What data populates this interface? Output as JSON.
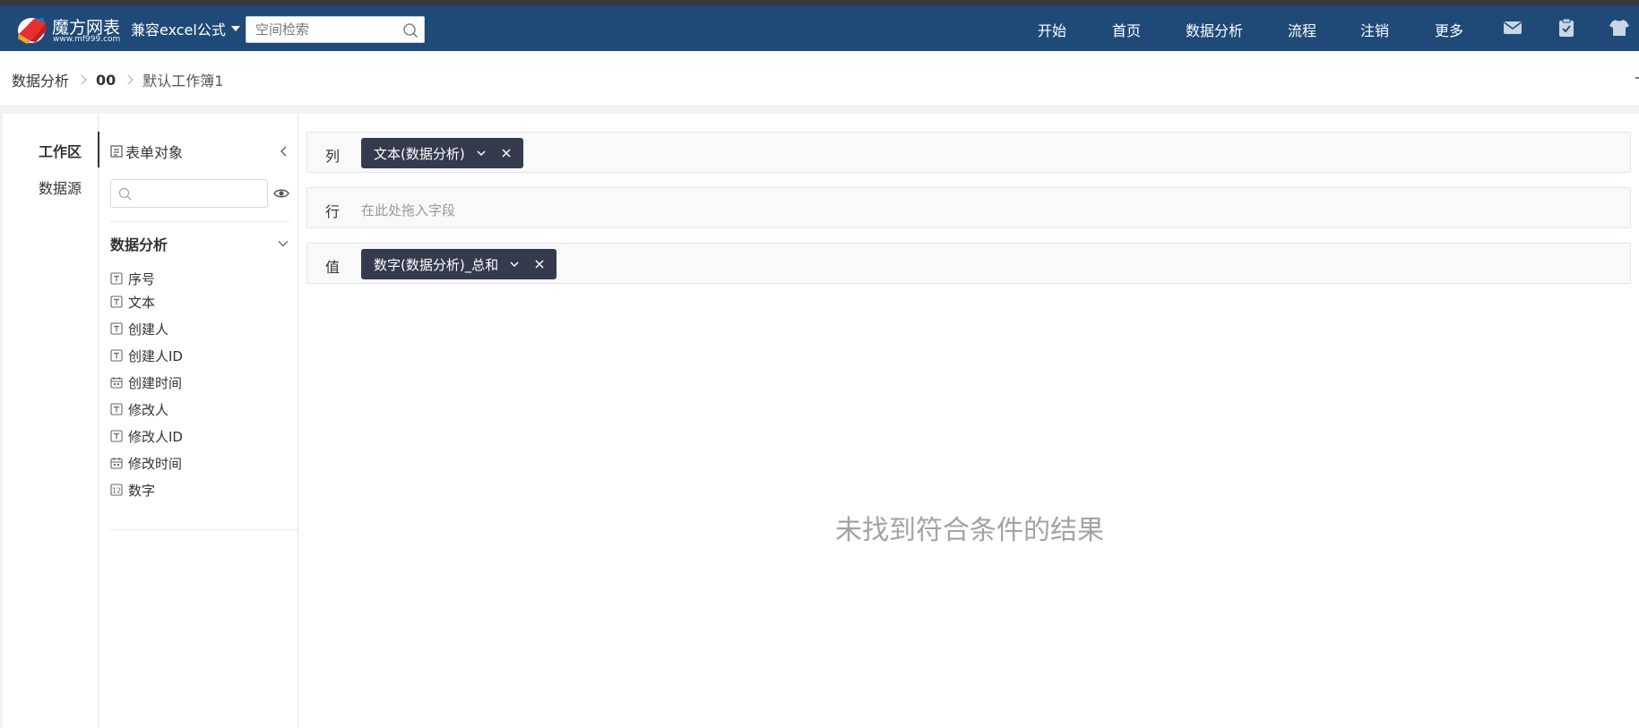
{
  "header": {
    "logo_title": "魔方网表",
    "logo_url": "www.mf999.com",
    "formula_mode": "兼容excel公式",
    "search_placeholder": "空间检索",
    "nav": [
      {
        "label": "开始"
      },
      {
        "label": "首页"
      },
      {
        "label": "数据分析"
      },
      {
        "label": "流程"
      },
      {
        "label": "注销"
      },
      {
        "label": "更多"
      }
    ],
    "icons": [
      "mail-icon",
      "clipboard-icon",
      "shirt-icon"
    ]
  },
  "breadcrumb": [
    "数据分析",
    "00",
    "默认工作簿1"
  ],
  "side_tabs": [
    "工作区",
    "数据源"
  ],
  "fields_panel": {
    "title": "表单对象",
    "search_placeholder": "",
    "group": "数据分析",
    "fields": [
      {
        "label": "序号",
        "type": "text"
      },
      {
        "label": "文本",
        "type": "text"
      },
      {
        "label": "创建人",
        "type": "text"
      },
      {
        "label": "创建人ID",
        "type": "text"
      },
      {
        "label": "创建时间",
        "type": "date"
      },
      {
        "label": "修改人",
        "type": "text"
      },
      {
        "label": "修改人ID",
        "type": "text"
      },
      {
        "label": "修改时间",
        "type": "date"
      },
      {
        "label": "数字",
        "type": "number"
      }
    ]
  },
  "shelves": {
    "columns": {
      "label": "列",
      "pill": "文本(数据分析)"
    },
    "rows": {
      "label": "行",
      "placeholder": "在此处拖入字段"
    },
    "values": {
      "label": "值",
      "pill": "数字(数据分析)_总和"
    }
  },
  "empty_message": "未找到符合条件的结果",
  "colors": {
    "header_bg": "#1f4a78",
    "pill_bg": "#353b4d"
  }
}
